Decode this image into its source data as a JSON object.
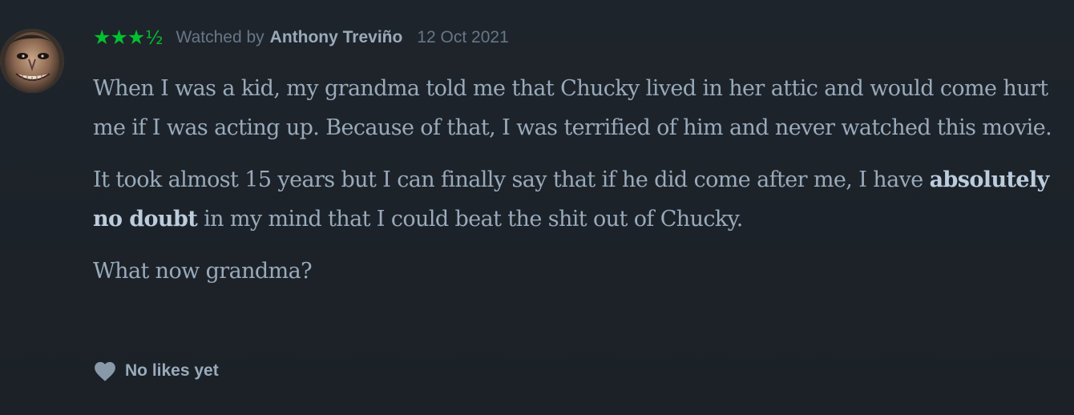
{
  "review": {
    "rating_stars": "★★★",
    "rating_half": "½",
    "watched_prefix": "Watched by",
    "author": "Anthony Treviño",
    "date": "12 Oct 2021",
    "paragraphs": [
      "When I was a kid, my grandma told me that Chucky lived in her attic and would come hurt me if I was acting up. Because of that, I was terrified of him and never watched this movie.",
      {
        "before": "It took almost 15 years but I can finally say that if he did come after me, I have",
        "bold": "absolutely no doubt",
        "after": "in my mind that I could beat the shit out of Chucky."
      },
      "What now grandma?"
    ],
    "likes_label": "No likes yet",
    "likes_icon": "heart-icon",
    "avatar_icon": "user-avatar-image"
  },
  "colors": {
    "background": "#1c2228",
    "star": "#00c030",
    "muted": "#667788",
    "text": "#99aabb",
    "strong": "#bbccdd"
  }
}
